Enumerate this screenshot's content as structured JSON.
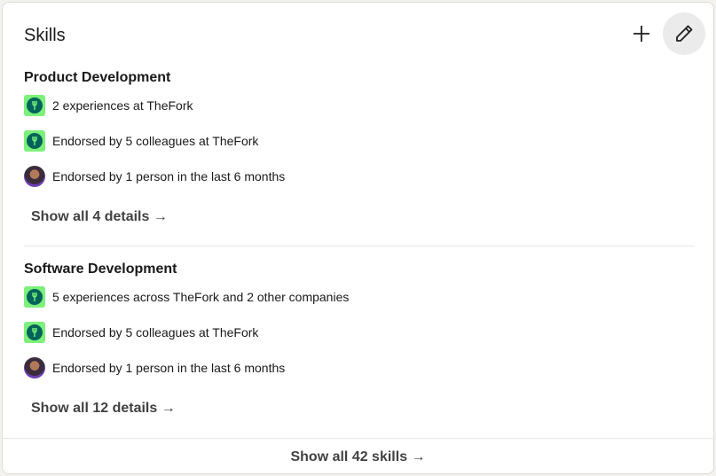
{
  "card": {
    "title": "Skills",
    "add_icon": "plus-icon",
    "edit_icon": "pencil-icon"
  },
  "skills": [
    {
      "name": "Product Development",
      "details": [
        {
          "icon": "thefork-logo",
          "text": "2 experiences at TheFork"
        },
        {
          "icon": "thefork-logo",
          "text": "Endorsed by 5 colleagues at  TheFork"
        },
        {
          "icon": "person-avatar",
          "text": "Endorsed by 1 person in the last 6 months"
        }
      ],
      "show_details": "Show all 4 details →"
    },
    {
      "name": "Software Development",
      "details": [
        {
          "icon": "thefork-logo",
          "text": "5 experiences across TheFork and 2 other companies"
        },
        {
          "icon": "thefork-logo",
          "text": "Endorsed by 5 colleagues at  TheFork"
        },
        {
          "icon": "person-avatar",
          "text": "Endorsed by 1 person in the last 6 months"
        }
      ],
      "show_details": "Show all 12 details →"
    }
  ],
  "footer": {
    "show_all": "Show all 42 skills →"
  },
  "colors": {
    "logo_bg": "#7cf07a",
    "logo_fg": "#00645a",
    "edit_button_bg": "#ebebeb"
  }
}
